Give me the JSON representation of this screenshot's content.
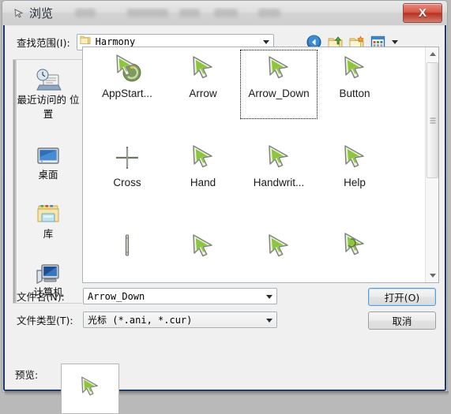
{
  "window": {
    "title": "浏览",
    "title_icon": "cursor-icon",
    "close_label": "X"
  },
  "lookin": {
    "label": "查找范围(I):",
    "value": "Harmony",
    "folder_icon": "folder-icon",
    "dropdown_icon": "chevron-down-icon"
  },
  "toolbar": {
    "buttons": [
      {
        "name": "back-button",
        "icon": "back-arrow-icon"
      },
      {
        "name": "up-one-level-button",
        "icon": "up-folder-icon"
      },
      {
        "name": "new-folder-button",
        "icon": "new-folder-icon"
      },
      {
        "name": "views-button",
        "icon": "views-grid-icon"
      }
    ],
    "views_caret_icon": "chevron-down-icon"
  },
  "places": {
    "items": [
      {
        "label": "最近访问的\n位置",
        "icon": "recent-places-icon"
      },
      {
        "label": "桌面",
        "icon": "desktop-icon"
      },
      {
        "label": "库",
        "icon": "libraries-icon"
      },
      {
        "label": "计算机",
        "icon": "computer-icon"
      }
    ]
  },
  "filelist": {
    "items": [
      {
        "label": "AppStart...",
        "icon": "cursor-appstart-icon",
        "selected": false
      },
      {
        "label": "Arrow",
        "icon": "cursor-arrow-icon",
        "selected": false
      },
      {
        "label": "Arrow_Down",
        "icon": "cursor-arrow-icon",
        "selected": true
      },
      {
        "label": "Button",
        "icon": "cursor-arrow-icon",
        "selected": false
      },
      {
        "label": "Cross",
        "icon": "cursor-cross-icon",
        "selected": false
      },
      {
        "label": "Hand",
        "icon": "cursor-arrow-icon",
        "selected": false
      },
      {
        "label": "Handwrit...",
        "icon": "cursor-arrow-icon",
        "selected": false
      },
      {
        "label": "Help",
        "icon": "cursor-arrow-icon",
        "selected": false
      },
      {
        "label": "",
        "icon": "cursor-ibeam-icon",
        "selected": false
      },
      {
        "label": "",
        "icon": "cursor-arrow-icon",
        "selected": false
      },
      {
        "label": "",
        "icon": "cursor-arrow-icon",
        "selected": false
      },
      {
        "label": "",
        "icon": "cursor-arrow-busy-icon",
        "selected": false
      }
    ],
    "scrollbar": {
      "up_icon": "scroll-up-icon",
      "down_icon": "scroll-down-icon"
    }
  },
  "form": {
    "filename_label": "文件名(N):",
    "filename_value": "Arrow_Down",
    "filetype_label": "文件类型(T):",
    "filetype_value": "光标 (*.ani, *.cur)",
    "open_button": "打开(O)",
    "cancel_button": "取消"
  },
  "preview": {
    "label": "预览:",
    "icon": "cursor-arrow-icon"
  },
  "colors": {
    "accent": "#5b9bd5",
    "close_red": "#b8301f",
    "frame_navy": "#1f3864",
    "cursor_green": "#8cc63f"
  }
}
